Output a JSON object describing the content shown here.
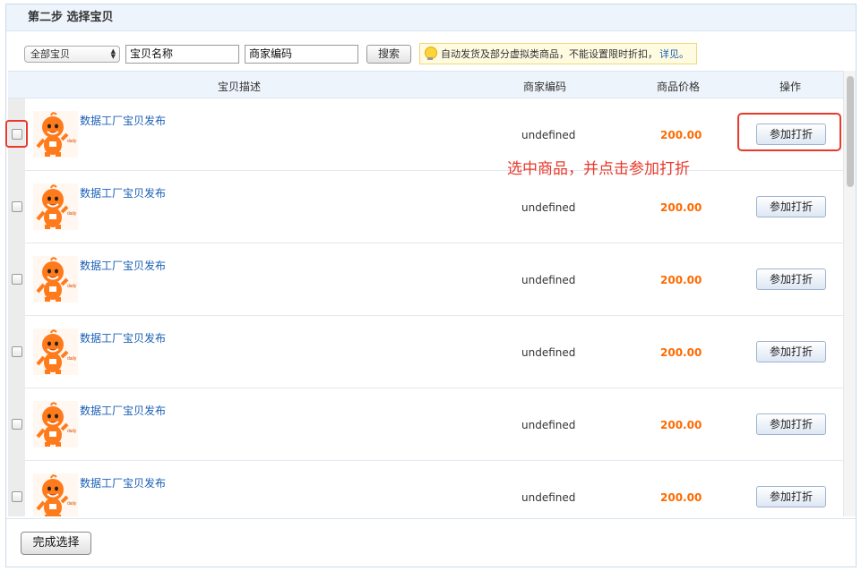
{
  "panel": {
    "title": "第二步 选择宝贝"
  },
  "toolbar": {
    "category_select": "全部宝贝",
    "name_input": "宝贝名称",
    "code_input": "商家编码",
    "search_label": "搜索",
    "tip_text": "自动发货及部分虚拟类商品，不能设置限时折扣，",
    "tip_link": "详见。"
  },
  "table": {
    "headers": {
      "desc": "宝贝描述",
      "code": "商家编码",
      "price": "商品价格",
      "action": "操作"
    },
    "rows": [
      {
        "title": "数据工厂宝贝发布",
        "code": "undefined",
        "price": "200.00",
        "action": "参加打折",
        "thumb_label": "daily"
      },
      {
        "title": "数据工厂宝贝发布",
        "code": "undefined",
        "price": "200.00",
        "action": "参加打折",
        "thumb_label": "daily"
      },
      {
        "title": "数据工厂宝贝发布",
        "code": "undefined",
        "price": "200.00",
        "action": "参加打折",
        "thumb_label": "daily"
      },
      {
        "title": "数据工厂宝贝发布",
        "code": "undefined",
        "price": "200.00",
        "action": "参加打折",
        "thumb_label": "daily"
      },
      {
        "title": "数据工厂宝贝发布",
        "code": "undefined",
        "price": "200.00",
        "action": "参加打折",
        "thumb_label": "daily"
      },
      {
        "title": "数据工厂宝贝发布",
        "code": "undefined",
        "price": "200.00",
        "action": "参加打折",
        "thumb_label": "daily"
      }
    ]
  },
  "footer": {
    "done_label": "完成选择"
  },
  "annotation": {
    "text": "选中商品，并点击参加打折"
  },
  "colors": {
    "price": "#ff6a00",
    "link": "#1a5fb4",
    "highlight": "#e8392b",
    "header_bg": "#eef4fb"
  },
  "icons": {
    "thumb": "mascot-icon",
    "tip": "lightbulb-icon",
    "select": "select-arrows-icon"
  }
}
